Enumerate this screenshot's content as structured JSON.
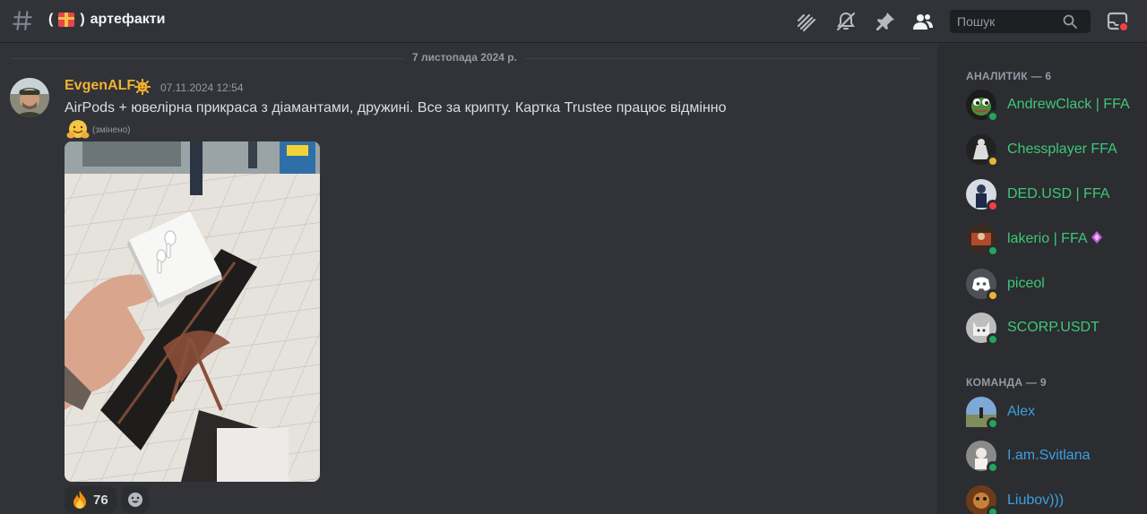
{
  "header": {
    "channel_name": "артефакти",
    "icons": [
      "hash-icon",
      "threads-icon",
      "mute-icon",
      "pin-icon",
      "members-icon",
      "inbox-icon"
    ],
    "search_placeholder": "Пошук"
  },
  "chat": {
    "date_divider": "7 листопада 2024 р.",
    "message": {
      "author": "EvgenALF",
      "timestamp": "07.11.2024 12:54",
      "text": "AirPods + ювелірна прикраса з діамантами, дружині. Все за крипту. Картка Trustee працює відмінно",
      "edited_label": "(змінено)",
      "reactions": [
        {
          "emoji": "fire",
          "count": "76"
        }
      ]
    }
  },
  "members": {
    "groups": [
      {
        "title": "АНАЛИТИК — 6",
        "items": [
          {
            "name": "AndrewClack | FFA",
            "status": "online",
            "color": "#3ec876"
          },
          {
            "name": "Chessplayer FFA",
            "status": "idle",
            "color": "#3ec876"
          },
          {
            "name": "DED.USD | FFA",
            "status": "dnd",
            "color": "#3ec876"
          },
          {
            "name": "lakerio | FFA",
            "status": "online",
            "color": "#3ec876"
          },
          {
            "name": "piceol",
            "status": "idle",
            "color": "#3ec876"
          },
          {
            "name": "SCORP.USDT",
            "status": "online",
            "color": "#3ec876"
          }
        ]
      },
      {
        "title": "КОМАНДА — 9",
        "items": [
          {
            "name": "Alex",
            "status": "online",
            "color": "#3e9fe0"
          },
          {
            "name": "I.am.Svitlana",
            "status": "online",
            "color": "#3e9fe0"
          },
          {
            "name": "Liubov)))",
            "status": "online",
            "color": "#3e9fe0"
          }
        ]
      }
    ]
  }
}
